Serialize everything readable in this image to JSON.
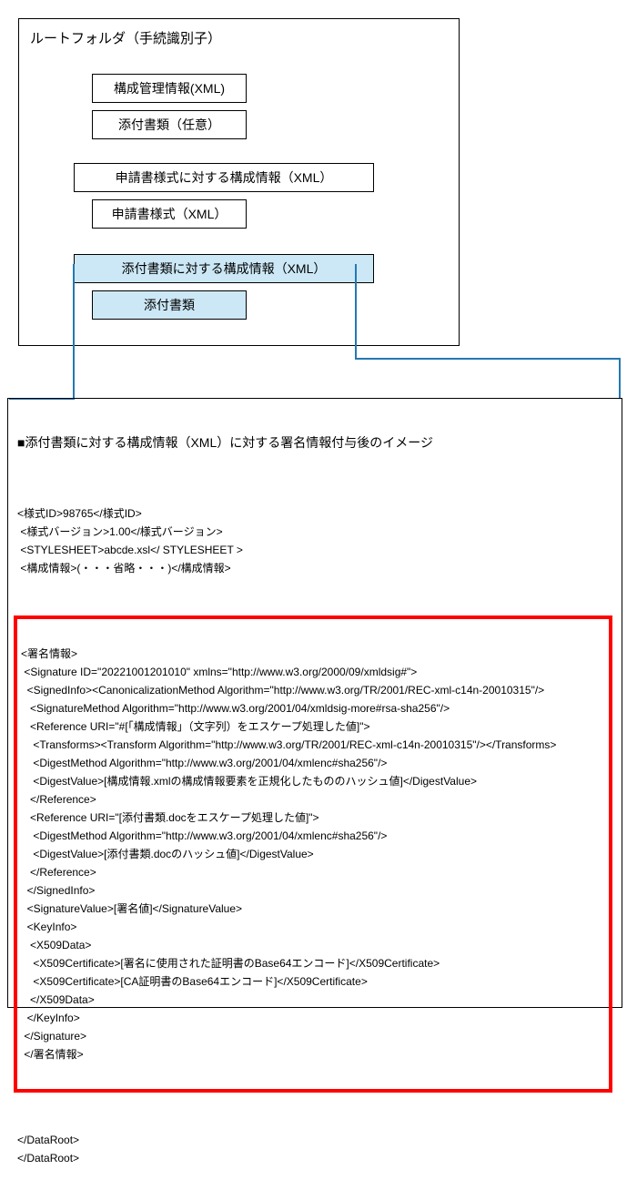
{
  "diagram": {
    "root_label": "ルートフォルダ（手続識別子）",
    "box1": "構成管理情報(XML)",
    "box2": "添付書類（任意）",
    "box3": "申請書様式に対する構成情報（XML）",
    "box4": "申請書様式（XML）",
    "box5": "添付書類に対する構成情報（XML）",
    "box6": "添付書類"
  },
  "detail": {
    "title": "■添付書類に対する構成情報（XML）に対する署名情報付与後のイメージ",
    "xml_head": [
      "<様式ID>98765</様式ID>",
      " <様式バージョン>1.00</様式バージョン>",
      " <STYLESHEET>abcde.xsl</ STYLESHEET >",
      " <構成情報>(・・・省略・・・)</構成情報>"
    ],
    "sig_lines": [
      "<署名情報>",
      " <Signature ID=\"20221001201010\" xmlns=\"http://www.w3.org/2000/09/xmldsig#\">",
      "  <SignedInfo><CanonicalizationMethod Algorithm=\"http://www.w3.org/TR/2001/REC-xml-c14n-20010315\"/>",
      "   <SignatureMethod Algorithm=\"http://www.w3.org/2001/04/xmldsig-more#rsa-sha256\"/>",
      "   <Reference URI=\"#[「構成情報」（文字列）をエスケープ処理した値]\">",
      "    <Transforms><Transform Algorithm=\"http://www.w3.org/TR/2001/REC-xml-c14n-20010315\"/></Transforms>",
      "    <DigestMethod Algorithm=\"http://www.w3.org/2001/04/xmlenc#sha256\"/>",
      "    <DigestValue>[構成情報.xmlの構成情報要素を正規化したもののハッシュ値]</DigestValue>",
      "   </Reference>",
      "   <Reference URI=\"[添付書類.docをエスケープ処理した値]\">",
      "    <DigestMethod Algorithm=\"http://www.w3.org/2001/04/xmlenc#sha256\"/>",
      "    <DigestValue>[添付書類.docのハッシュ値]</DigestValue>",
      "   </Reference>",
      "  </SignedInfo>",
      "  <SignatureValue>[署名値]</SignatureValue>",
      "  <KeyInfo>",
      "   <X509Data>",
      "    <X509Certificate>[署名に使用された証明書のBase64エンコード]</X509Certificate>",
      "    <X509Certificate>[CA証明書のBase64エンコード]</X509Certificate>",
      "   </X509Data>",
      "  </KeyInfo>",
      " </Signature>",
      " </署名情報>"
    ],
    "xml_tail": [
      "</DataRoot>",
      "</DataRoot>"
    ]
  }
}
